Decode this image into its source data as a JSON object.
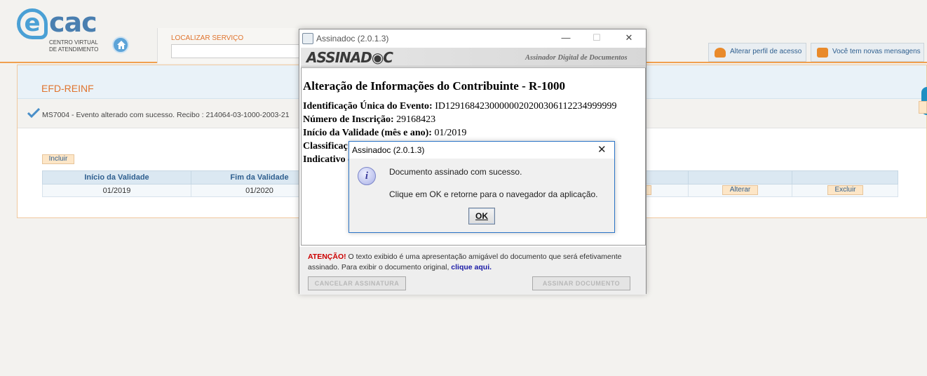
{
  "header": {
    "logo_big": "cac",
    "logo_e": "e",
    "logo_line1": "CENTRO VIRTUAL",
    "logo_line2": "DE ATENDIMENTO",
    "search_label": "LOCALIZAR SERVIÇO",
    "search_value": "",
    "btn_perfil": "Alterar perfil de acesso",
    "btn_msg": "Você tem novas mensagens"
  },
  "main": {
    "title": "EFD-REINF",
    "message": "MS7004 - Evento alterado com sucesso. Recibo : 214064-03-1000-2003-21",
    "btn_incluir": "Incluir",
    "table": {
      "headers": [
        "Início da Validade",
        "Fim da Validade",
        "",
        "",
        ""
      ],
      "rows": [
        [
          "01/2019",
          "01/2020",
          "",
          "",
          ""
        ]
      ]
    },
    "btn_alterar": "Alterar",
    "btn_excluir": "Excluir"
  },
  "assinadoc": {
    "title": "Assinadoc (2.0.1.3)",
    "banner_logo": "ASSINAD◉C",
    "banner_sub": "Assinador Digital de Documentos",
    "heading": "Alteração de Informações do Contribuinte - R-1000",
    "lines": [
      {
        "label": "Identificação Única do Evento:",
        "value": "ID12916842300000020200306112234999999"
      },
      {
        "label": "Número de Inscrição:",
        "value": "29168423"
      },
      {
        "label": "Início da Validade (mês e ano):",
        "value": "01/2019"
      },
      {
        "label": "Classificaç",
        "value": ""
      },
      {
        "label": "Indicativo d",
        "value": ""
      }
    ],
    "att_label": "ATENÇÃO!",
    "att_text": " O texto exibido é uma apresentação amigável do documento que será efetivamente assinado. Para exibir o documento original, ",
    "att_link": "clique aqui.",
    "btn_cancel": "CANCELAR ASSINATURA",
    "btn_assinar": "ASSINAR DOCUMENTO"
  },
  "dialog": {
    "title": "Assinadoc (2.0.1.3)",
    "icon": "i",
    "msg1": "Documento assinado com sucesso.",
    "msg2": "Clique em OK e retorne para o navegador da aplicação.",
    "ok": "OK"
  },
  "colors": {
    "accent_orange": "#e0742e",
    "link_blue": "#2f5f8f",
    "dialog_border": "#2b74c7",
    "attention_red": "#cc0000"
  }
}
